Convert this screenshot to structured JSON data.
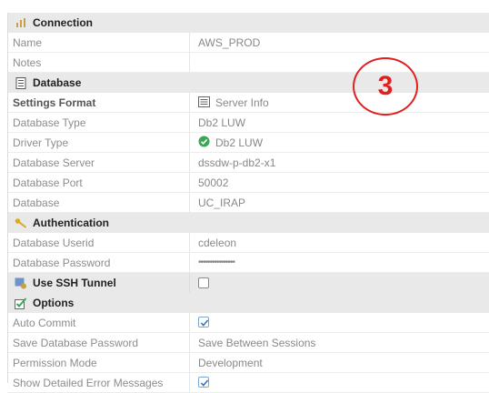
{
  "sections": {
    "connection": {
      "title": "Connection",
      "icon": "connection-icon"
    },
    "database": {
      "title": "Database",
      "icon": "database-icon"
    },
    "authentication": {
      "title": "Authentication",
      "icon": "key-icon"
    },
    "ssh": {
      "title": "Use SSH Tunnel",
      "icon": "ssh-tunnel-icon"
    },
    "options": {
      "title": "Options",
      "icon": "options-icon"
    }
  },
  "connection": {
    "name_label": "Name",
    "name_value": "AWS_PROD",
    "notes_label": "Notes",
    "notes_value": ""
  },
  "database": {
    "settings_label": "Settings Format",
    "settings_value": "Server Info",
    "type_label": "Database Type",
    "type_value": "Db2 LUW",
    "driver_label": "Driver Type",
    "driver_value": "Db2 LUW",
    "server_label": "Database Server",
    "server_value": "dssdw-p-db2-x1",
    "port_label": "Database Port",
    "port_value": "50002",
    "db_label": "Database",
    "db_value": "UC_IRAP"
  },
  "authentication": {
    "userid_label": "Database Userid",
    "userid_value": "cdeleon",
    "password_label": "Database Password",
    "password_value": "••••••••••••••••"
  },
  "ssh": {
    "checked": false
  },
  "options": {
    "autocommit_label": "Auto Commit",
    "autocommit_checked": true,
    "savepw_label": "Save Database Password",
    "savepw_value": "Save Between Sessions",
    "permission_label": "Permission Mode",
    "permission_value": "Development",
    "errors_label": "Show Detailed Error Messages",
    "errors_checked": true
  },
  "annotation": {
    "number": "3",
    "color": "#e02020"
  },
  "colors": {
    "section_bg": "#e9e9e9",
    "check_blue": "#2a78c8",
    "ok_green": "#3aa657"
  }
}
